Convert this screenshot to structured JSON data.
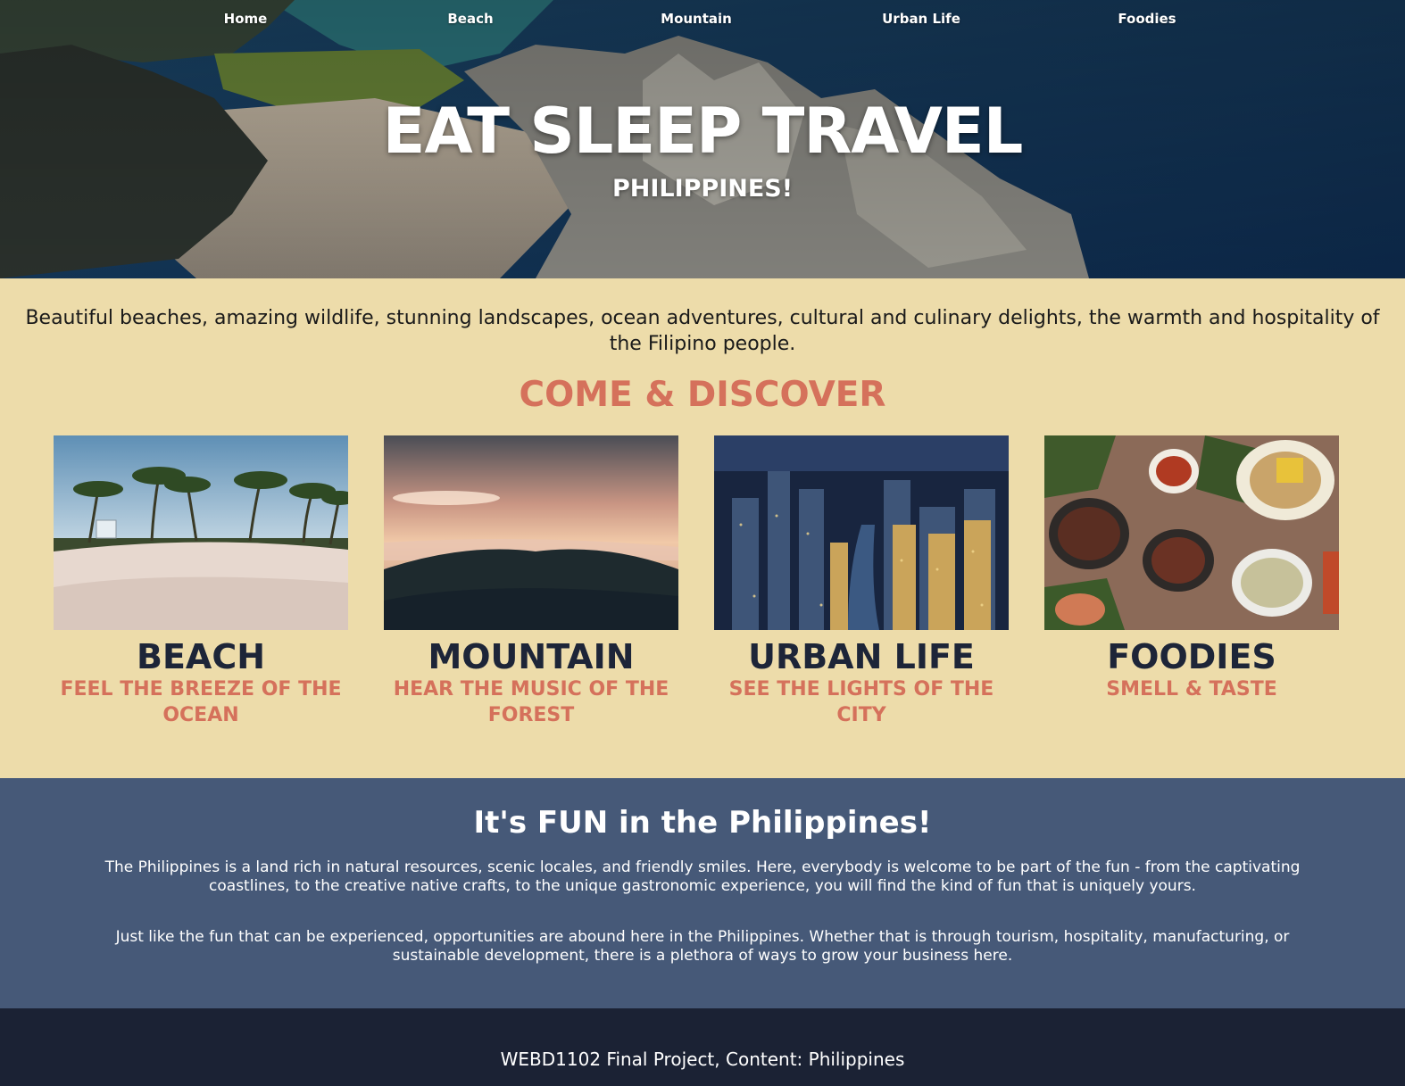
{
  "nav": {
    "items": [
      {
        "label": "Home"
      },
      {
        "label": "Beach"
      },
      {
        "label": "Mountain"
      },
      {
        "label": "Urban Life"
      },
      {
        "label": "Foodies"
      }
    ]
  },
  "hero": {
    "title": "EAT SLEEP TRAVEL",
    "subtitle": "PHILIPPINES!"
  },
  "discover": {
    "intro": "Beautiful beaches, amazing wildlife, stunning landscapes, ocean adventures, cultural and culinary delights, the warmth and hospitality of the Filipino people.",
    "title": "COME & DISCOVER",
    "cards": [
      {
        "title": "BEACH",
        "subtitle": "FEEL THE BREEZE OF THE OCEAN"
      },
      {
        "title": "MOUNTAIN",
        "subtitle": "HEAR THE MUSIC OF THE FOREST"
      },
      {
        "title": "URBAN LIFE",
        "subtitle": "SEE THE LIGHTS OF THE CITY"
      },
      {
        "title": "FOODIES",
        "subtitle": "SMELL & TASTE"
      }
    ]
  },
  "fun": {
    "title": "It's FUN in the Philippines!",
    "paragraphs": [
      "The Philippines is a land rich in natural resources, scenic locales, and friendly smiles. Here, everybody is welcome to be part of the fun - from the captivating coastlines, to the creative native crafts, to the unique gastronomic experience, you will find the kind of fun that is uniquely yours.",
      "Just like the fun that can be experienced, opportunities are abound here in the Philippines. Whether that is through tourism, hospitality, manufacturing, or sustainable development, there is a plethora of ways to grow your business here."
    ]
  },
  "footer": {
    "text": "WEBD1102 Final Project, Content: Philippines"
  },
  "colors": {
    "discover_bg": "#eddcaa",
    "accent": "#d5715b",
    "heading_dark": "#1d2538",
    "fun_bg": "#465978",
    "footer_bg": "#1b2234"
  }
}
